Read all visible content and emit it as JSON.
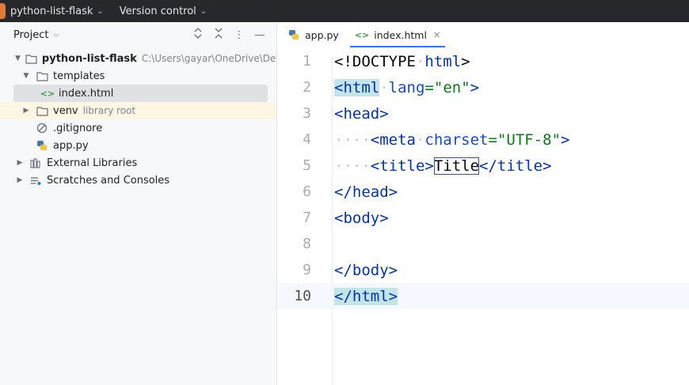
{
  "titlebar": {
    "project_name": "python-list-flask",
    "vcs_label": "Version control"
  },
  "project_panel": {
    "title": "Project",
    "tree": [
      {
        "label": "python-list-flask",
        "hint": "C:\\Users\\gayar\\OneDrive\\Des",
        "type": "folder",
        "expanded": true,
        "level": 0
      },
      {
        "label": "templates",
        "type": "folder",
        "expanded": true,
        "level": 1
      },
      {
        "label": "index.html",
        "type": "html",
        "level": 2,
        "selected": true
      },
      {
        "label": "venv",
        "hint": "library root",
        "type": "folder",
        "expanded": false,
        "level": 1
      },
      {
        "label": ".gitignore",
        "type": "ignore",
        "level": 1
      },
      {
        "label": "app.py",
        "type": "python",
        "level": 1
      },
      {
        "label": "External Libraries",
        "type": "library",
        "expanded": false,
        "level": 0
      },
      {
        "label": "Scratches and Consoles",
        "type": "scratch",
        "expanded": false,
        "level": 0
      }
    ]
  },
  "editor": {
    "tabs": [
      {
        "label": "app.py",
        "type": "python",
        "active": false
      },
      {
        "label": "index.html",
        "type": "html",
        "active": true
      }
    ],
    "line_numbers": [
      "1",
      "2",
      "3",
      "4",
      "5",
      "6",
      "7",
      "8",
      "9",
      "10"
    ],
    "code": {
      "l1_open": "<!DOCTYPE",
      "l1_name": "html",
      "l1_close": ">",
      "l2_open": "<html",
      "l2_attr": "lang",
      "l2_eq": "=",
      "l2_val": "\"en\"",
      "l2_close": ">",
      "l3": "<head>",
      "l4_indent": "····",
      "l4_open": "<meta",
      "l4_attr": "charset",
      "l4_eq": "=",
      "l4_val": "\"UTF-8\"",
      "l4_close": ">",
      "l5_indent": "····",
      "l5_open": "<title>",
      "l5_text": "Title",
      "l5_close": "</title>",
      "l6": "</head>",
      "l7": "<body>",
      "l9": "</body>",
      "l10": "</html>"
    }
  },
  "colors": {
    "titlebar_bg": "#27282c",
    "tab_underline": "#3574f0",
    "tag": "#0033b3",
    "string": "#067d17",
    "brace_match": "#c3e5e8"
  }
}
